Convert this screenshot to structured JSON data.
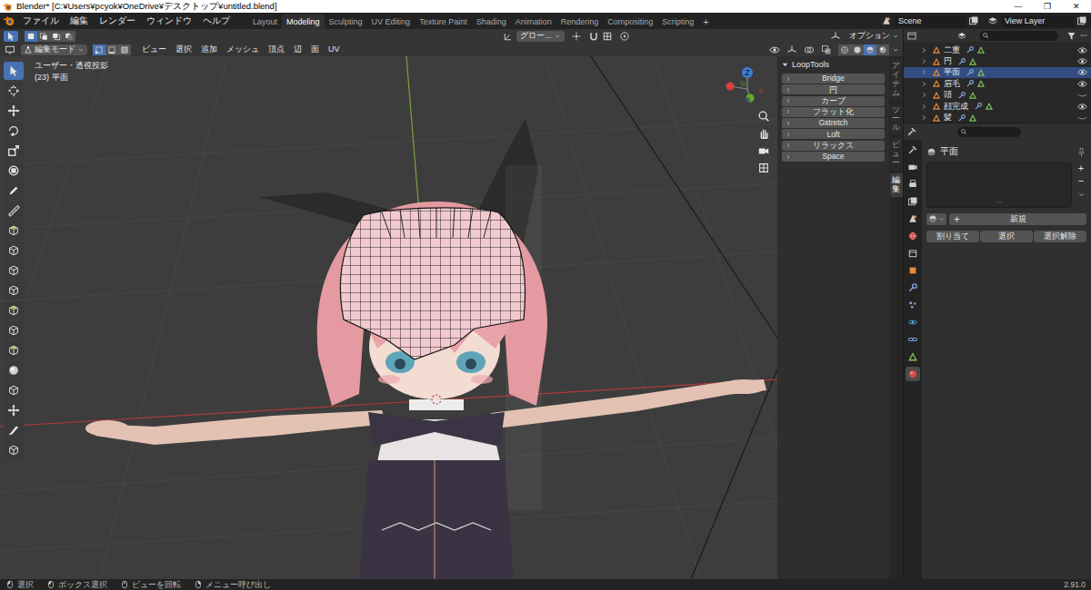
{
  "window": {
    "title": "Blender* [C:¥Users¥pcyok¥OneDrive¥デスクトップ¥untitled.blend]",
    "controls": [
      "—",
      "❐",
      "✕"
    ]
  },
  "menu": [
    "ファイル",
    "編集",
    "レンダー",
    "ウィンドウ",
    "ヘルプ"
  ],
  "workspaces": [
    {
      "label": "Layout",
      "selected": false
    },
    {
      "label": "Modeling",
      "selected": true
    },
    {
      "label": "Sculpting",
      "selected": false
    },
    {
      "label": "UV Editing",
      "selected": false
    },
    {
      "label": "Texture Paint",
      "selected": false
    },
    {
      "label": "Shading",
      "selected": false
    },
    {
      "label": "Animation",
      "selected": false
    },
    {
      "label": "Rendering",
      "selected": false
    },
    {
      "label": "Compositing",
      "selected": false
    },
    {
      "label": "Scripting",
      "selected": false
    }
  ],
  "add_workspace": "+",
  "scene": "Scene",
  "view_layer": "View Layer",
  "viewport": {
    "mode": "編集モード",
    "select_box_modes": [
      {
        "selected": true
      },
      {
        "selected": false
      },
      {
        "selected": false
      },
      {
        "selected": false
      }
    ],
    "select_modes": [
      {
        "selected": true
      },
      {
        "selected": false
      },
      {
        "selected": false
      }
    ],
    "menus": [
      "ビュー",
      "選択",
      "追加",
      "メッシュ",
      "頂点",
      "辺",
      "面",
      "UV"
    ],
    "orientation": "グロー...",
    "options": "オプション",
    "shading": [
      {
        "selected": false
      },
      {
        "selected": false
      },
      {
        "selected": true
      },
      {
        "selected": false
      }
    ],
    "view_name": "ユーザー・透視投影",
    "object_info": "(23) 平面",
    "gizmo_axis": "Z"
  },
  "toolbar": [
    {
      "selected": true
    },
    {
      "selected": false
    },
    {
      "selected": false
    },
    {
      "selected": false
    },
    {
      "selected": false
    },
    {
      "selected": false
    },
    {
      "selected": false
    },
    {
      "selected": false
    },
    {
      "selected": false
    },
    {
      "selected": false
    },
    {
      "selected": false
    },
    {
      "selected": false
    },
    {
      "selected": false
    },
    {
      "selected": false
    },
    {
      "selected": false
    },
    {
      "selected": false
    },
    {
      "selected": false
    },
    {
      "selected": false
    },
    {
      "selected": false
    },
    {
      "selected": false
    }
  ],
  "looptools": {
    "title": "LoopTools",
    "expanded": true,
    "items": [
      "Bridge",
      "円",
      "カーブ",
      "フラット化",
      "Gstretch",
      "Loft",
      "リラックス",
      "Space"
    ]
  },
  "side_tabs": [
    {
      "label": "アイテム",
      "selected": false
    },
    {
      "label": "ツール",
      "selected": false
    },
    {
      "label": "ビュー",
      "selected": false
    },
    {
      "label": "編集",
      "selected": true
    }
  ],
  "outliner": {
    "items": [
      {
        "label": "二重",
        "visible": true,
        "selected": false
      },
      {
        "label": "円",
        "visible": true,
        "selected": false
      },
      {
        "label": "平面",
        "visible": true,
        "selected": true
      },
      {
        "label": "眉毛",
        "visible": true,
        "selected": false
      },
      {
        "label": "頭",
        "visible": false,
        "selected": false
      },
      {
        "label": "顔完成",
        "visible": true,
        "selected": false
      },
      {
        "label": "髪",
        "visible": false,
        "selected": false
      }
    ]
  },
  "properties": {
    "tabs": [
      {
        "selected": false
      },
      {
        "selected": false
      },
      {
        "selected": false
      },
      {
        "selected": false
      },
      {
        "selected": false
      },
      {
        "selected": false
      },
      {
        "selected": false
      },
      {
        "selected": false
      },
      {
        "selected": false
      },
      {
        "selected": false
      },
      {
        "selected": false
      },
      {
        "selected": false
      },
      {
        "selected": false
      },
      {
        "selected": true
      }
    ],
    "title": "平面",
    "add": "+",
    "remove": "−",
    "new": "新規",
    "buttons": [
      "割り当て",
      "選択",
      "選択解除"
    ]
  },
  "status_bar": {
    "items": [
      "選択",
      "ボックス選択",
      "ビューを回転",
      "メニュー呼び出し"
    ],
    "version": "2.91.0"
  }
}
